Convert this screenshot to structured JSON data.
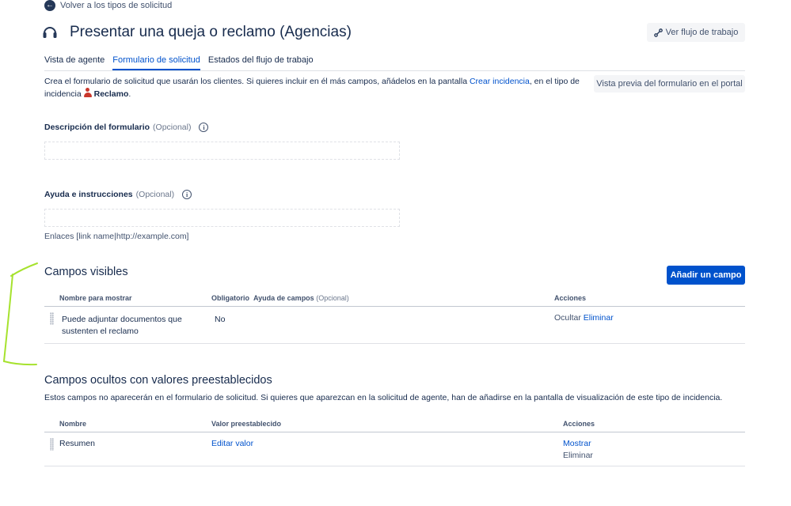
{
  "header": {
    "back_label": "Volver a los tipos de solicitud",
    "page_title": "Presentar una queja o reclamo (Agencias)",
    "workflow_button": "Ver flujo de trabajo"
  },
  "tabs": [
    {
      "label": "Vista de agente",
      "active": false
    },
    {
      "label": "Formulario de solicitud",
      "active": true
    },
    {
      "label": "Estados del flujo de trabajo",
      "active": false
    }
  ],
  "intro": {
    "text_before_link": "Crea el formulario de solicitud que usarán los clientes. Si quieres incluir en él más campos, añádelos en la pantalla ",
    "link": "Crear incidencia",
    "text_after_link": ", en el tipo de incidencia",
    "issue_type": "Reclamo",
    "end": ".",
    "preview_button": "Vista previa del formulario en el portal"
  },
  "form": {
    "description_label": "Descripción del formulario",
    "description_optional": "(Opcional)",
    "description_value": "",
    "help_label": "Ayuda e instrucciones",
    "help_optional": "(Opcional)",
    "help_value": "",
    "links_hint": "Enlaces [link name|http://example.com]"
  },
  "visible_fields": {
    "title": "Campos visibles",
    "add_button": "Añadir un campo",
    "columns": {
      "name": "Nombre para mostrar",
      "required": "Obligatorio",
      "help": "Ayuda de campos",
      "help_optional": "(Opcional)",
      "actions": "Acciones"
    },
    "rows": [
      {
        "name_line1": "Puede adjuntar documentos que",
        "name_line2": "sustenten el reclamo",
        "required": "No",
        "action_hide": "Ocultar",
        "action_delete": "Eliminar"
      }
    ]
  },
  "hidden_fields": {
    "title": "Campos ocultos con valores preestablecidos",
    "description": "Estos campos no aparecerán en el formulario de solicitud. Si quieres que aparezcan en la solicitud de agente, han de añadirse en la pantalla de visualización de este tipo de incidencia.",
    "columns": {
      "name": "Nombre",
      "value": "Valor preestablecido",
      "actions": "Acciones"
    },
    "rows": [
      {
        "name": "Resumen",
        "value_action": "Editar valor",
        "action_show": "Mostrar",
        "action_delete": "Eliminar"
      }
    ]
  },
  "colors": {
    "link": "#0052cc",
    "primary_button": "#0052cc",
    "issue_icon": "#c9372c",
    "annotation": "#a6e22e"
  },
  "icons": {
    "back": "arrow-left-circle-icon",
    "title": "headset-icon",
    "workflow": "workflow-icon",
    "issue_type": "person-icon",
    "info": "info-icon",
    "drag": "drag-handle-icon"
  }
}
